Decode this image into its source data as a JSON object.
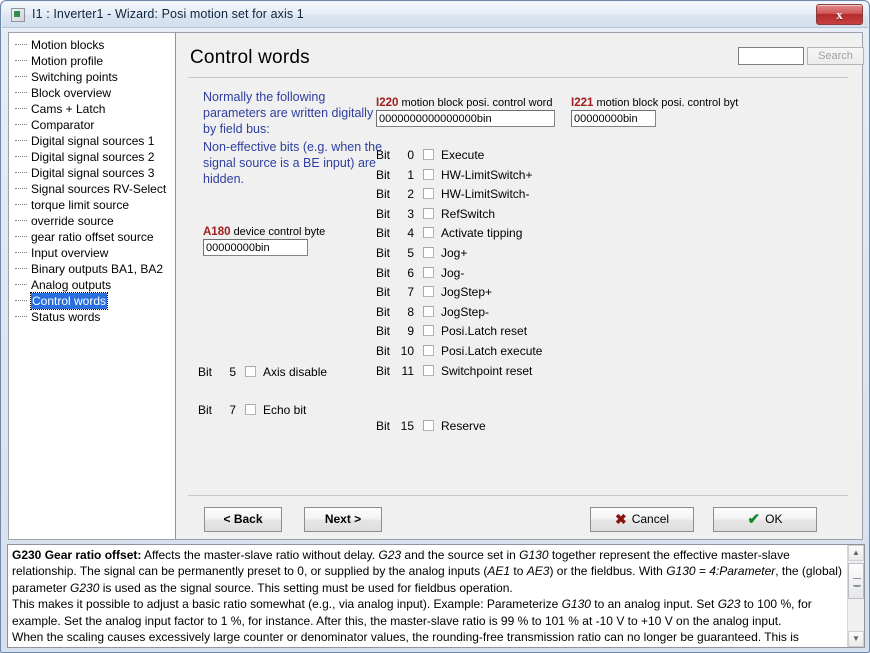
{
  "window": {
    "title": "I1 : Inverter1 - Wizard: Posi motion set for axis 1",
    "close_label": "x"
  },
  "sidebar": {
    "items": [
      {
        "label": "Motion blocks",
        "selected": false
      },
      {
        "label": "Motion profile",
        "selected": false
      },
      {
        "label": "Switching points",
        "selected": false
      },
      {
        "label": "Block overview",
        "selected": false
      },
      {
        "label": "Cams + Latch",
        "selected": false
      },
      {
        "label": "Comparator",
        "selected": false
      },
      {
        "label": "Digital signal sources 1",
        "selected": false
      },
      {
        "label": "Digital signal sources 2",
        "selected": false
      },
      {
        "label": "Digital signal sources 3",
        "selected": false
      },
      {
        "label": "Signal sources RV-Select",
        "selected": false
      },
      {
        "label": "torque limit source",
        "selected": false
      },
      {
        "label": "override source",
        "selected": false
      },
      {
        "label": "gear ratio offset source",
        "selected": false
      },
      {
        "label": "Input overview",
        "selected": false
      },
      {
        "label": "Binary outputs BA1, BA2",
        "selected": false
      },
      {
        "label": "Analog outputs",
        "selected": false
      },
      {
        "label": "Control words",
        "selected": true
      },
      {
        "label": "Status words",
        "selected": false
      }
    ]
  },
  "main": {
    "page_title": "Control words",
    "search": {
      "value": "",
      "placeholder": "",
      "button_label": "Search"
    },
    "notes": {
      "note_1": "Normally the following parameters are written digitally by field bus:",
      "note_2": "Non-effective bits (e.g. when the signal source is a BE input) are hidden."
    },
    "params": {
      "i220": {
        "code": "I220",
        "label": "motion block posi. control word",
        "value": "0000000000000000bin"
      },
      "i221": {
        "code": "I221",
        "label": "motion block posi. control byt",
        "value": "00000000bin"
      },
      "a180": {
        "code": "A180",
        "label": "device control byte",
        "value": "00000000bin"
      }
    },
    "bits_word": {
      "prefix": "Bit",
      "rows": [
        {
          "num": "0",
          "label": "Execute",
          "checked": false
        },
        {
          "num": "1",
          "label": "HW-LimitSwitch+",
          "checked": false
        },
        {
          "num": "2",
          "label": "HW-LimitSwitch-",
          "checked": false
        },
        {
          "num": "3",
          "label": "RefSwitch",
          "checked": false
        },
        {
          "num": "4",
          "label": "Activate tipping",
          "checked": false
        },
        {
          "num": "5",
          "label": "Jog+",
          "checked": false
        },
        {
          "num": "6",
          "label": "Jog-",
          "checked": false
        },
        {
          "num": "7",
          "label": "JogStep+",
          "checked": false
        },
        {
          "num": "8",
          "label": "JogStep-",
          "checked": false
        },
        {
          "num": "9",
          "label": "Posi.Latch reset",
          "checked": false
        },
        {
          "num": "10",
          "label": "Posi.Latch execute",
          "checked": false
        },
        {
          "num": "11",
          "label": "Switchpoint reset",
          "checked": false
        }
      ]
    },
    "bits_byte": {
      "prefix": "Bit",
      "rows": [
        {
          "num": "5",
          "label": "Axis disable",
          "checked": false
        },
        {
          "num": "7",
          "label": "Echo bit",
          "checked": false
        }
      ]
    },
    "bits_reserve": {
      "prefix": "Bit",
      "rows": [
        {
          "num": "15",
          "label": "Reserve",
          "checked": false
        }
      ]
    },
    "buttons": {
      "back": "< Back",
      "next": "Next >",
      "cancel": "Cancel",
      "ok": "OK"
    }
  },
  "help": {
    "code": "G230",
    "heading": "Gear ratio offset:",
    "body_1": " Affects the master-slave ratio without delay. ",
    "em_1": "G23",
    "body_2": " and the source set in ",
    "em_2": "G130",
    "body_3": " together represent the effective master-slave relationship. The signal can be permanently preset to 0, or supplied by the analog inputs (",
    "em_3": "AE1",
    "body_4": " to ",
    "em_4": "AE3",
    "body_5": ") or the fieldbus. With ",
    "em_5": "G130 = 4:Parameter",
    "body_6": ", the (global) parameter ",
    "em_6": "G230",
    "body_7": " is used as the signal source. This setting must be used for fieldbus operation.",
    "body_8": "This makes it possible to adjust a basic ratio somewhat (e.g., via analog input). Example: Parameterize ",
    "em_7": "G130",
    "body_9": " to an analog input. Set ",
    "em_8": "G23",
    "body_10": " to 100 %, for example. Set the analog input factor to 1 %, for instance. After this, the master-slave ratio is 99 % to 101 % at -10 V to +10 V on the analog input.",
    "body_11": "When the scaling causes excessively large counter or denominator values, the rounding-free transmission ratio can no longer be guaranteed. This is"
  },
  "colors": {
    "param_code": "#a01d1d",
    "note_text": "#2e3f9e",
    "selection": "#2a6fe0",
    "cancel_glyph": "#8b1111",
    "ok_glyph": "#118b2a"
  }
}
